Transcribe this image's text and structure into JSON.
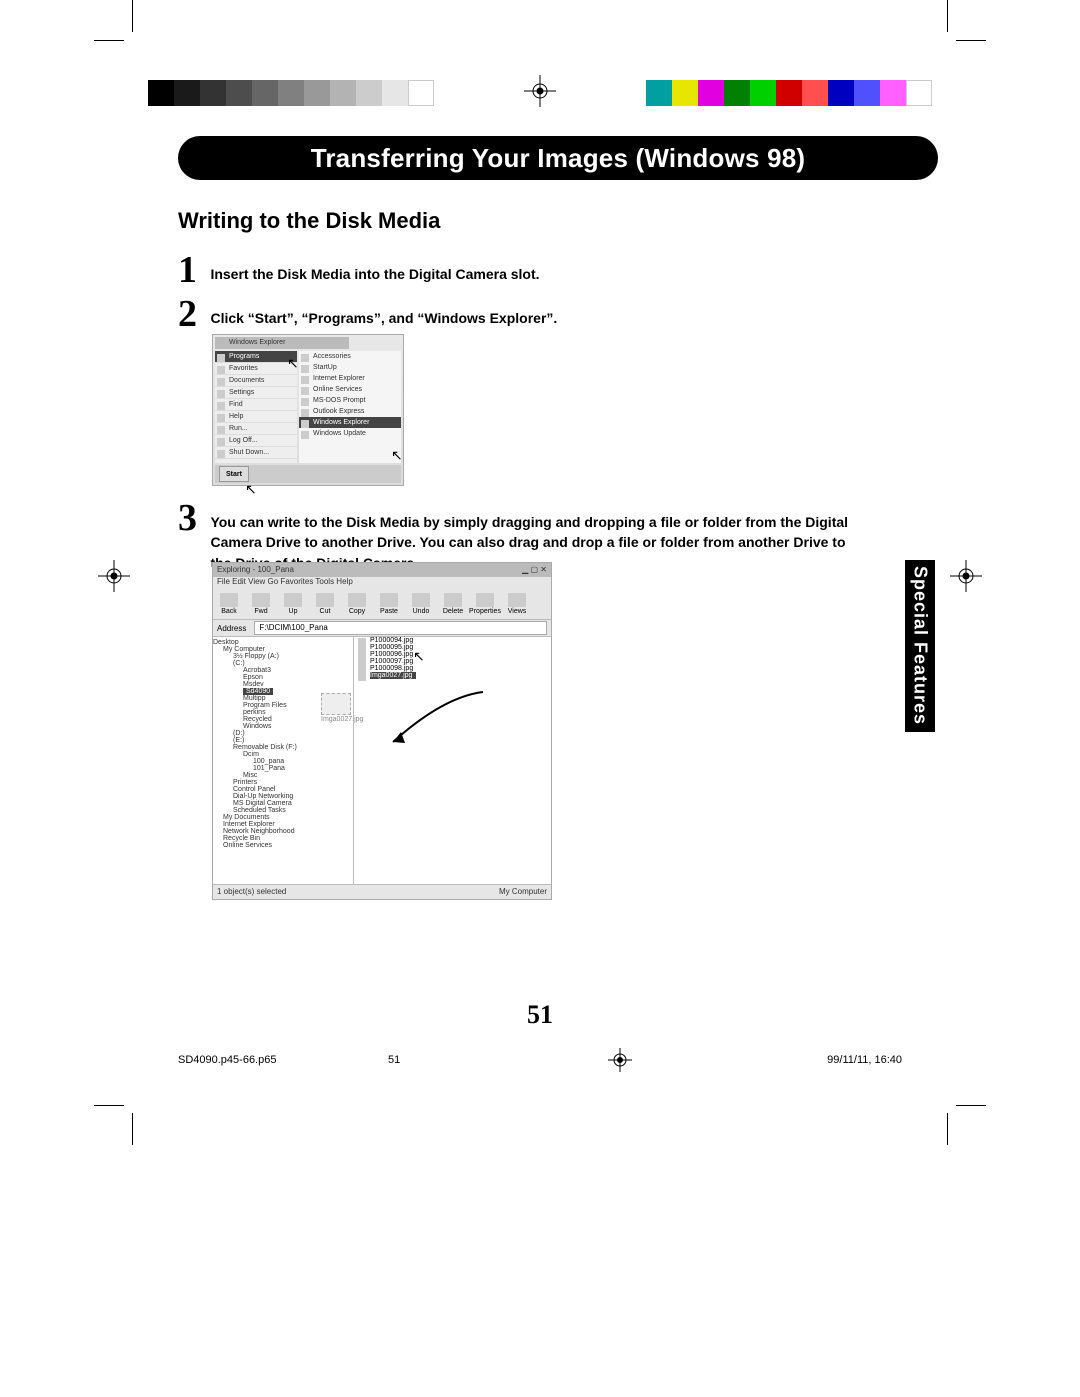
{
  "banner_title": "Transferring Your Images (Windows 98)",
  "subtitle": "Writing to the Disk Media",
  "steps": {
    "s1_num": "1",
    "s1_text": "Insert the Disk Media into the Digital Camera slot.",
    "s2_num": "2",
    "s2_text": "Click “Start”, “Programs”, and “Windows Explorer”.",
    "s3_num": "3",
    "s3_text": "You can write to the Disk Media by simply dragging and dropping a file or folder from the Digital Camera Drive to another Drive. You can also drag and drop a file or folder from another Drive to the Drive of the Digital Camera."
  },
  "fig1": {
    "window_title": "Windows Explorer",
    "left_items": [
      "Programs",
      "Favorites",
      "Documents",
      "Settings",
      "Find",
      "Help",
      "Run...",
      "Log Off...",
      "Shut Down..."
    ],
    "left_selected": "Programs",
    "right_items": [
      "Accessories",
      "StartUp",
      "Internet Explorer",
      "Online Services",
      "MS-DOS Prompt",
      "Outlook Express",
      "Windows Explorer",
      "Windows Update"
    ],
    "right_selected": "Windows Explorer",
    "start_label": "Start"
  },
  "fig2": {
    "titlebar": "Exploring - 100_Pana",
    "menubar": "File  Edit  View  Go  Favorites  Tools  Help",
    "toolbar_items": [
      "Back",
      "Fwd",
      "Up",
      "Cut",
      "Copy",
      "Paste",
      "Undo",
      "Delete",
      "Properties",
      "Views"
    ],
    "address_label": "Address",
    "address_value": "F:\\DCIM\\100_Pana",
    "tree": [
      {
        "t": "Desktop",
        "lvl": 0
      },
      {
        "t": "My Computer",
        "lvl": 1
      },
      {
        "t": "3½ Floppy (A:)",
        "lvl": 2
      },
      {
        "t": "(C:)",
        "lvl": 2
      },
      {
        "t": "Acrobat3",
        "lvl": 3
      },
      {
        "t": "Epson",
        "lvl": 3
      },
      {
        "t": "Msdev",
        "lvl": 3
      },
      {
        "t": "My Documents",
        "lvl": 3,
        "sel": true,
        "selLabel": "Sd4090"
      },
      {
        "t": "Multipp",
        "lvl": 3
      },
      {
        "t": "Program Files",
        "lvl": 3
      },
      {
        "t": "perkins",
        "lvl": 3
      },
      {
        "t": "Recycled",
        "lvl": 3
      },
      {
        "t": "Windows",
        "lvl": 3
      },
      {
        "t": "(D:)",
        "lvl": 2
      },
      {
        "t": "(E:)",
        "lvl": 2
      },
      {
        "t": "Removable Disk (F:)",
        "lvl": 2
      },
      {
        "t": "Dcim",
        "lvl": 3
      },
      {
        "t": "100_pana",
        "lvl": 4
      },
      {
        "t": "101_Pana",
        "lvl": 4
      },
      {
        "t": "Misc",
        "lvl": 3
      },
      {
        "t": "Printers",
        "lvl": 2
      },
      {
        "t": "Control Panel",
        "lvl": 2
      },
      {
        "t": "Dial-Up Networking",
        "lvl": 2
      },
      {
        "t": "MS Digital Camera",
        "lvl": 2
      },
      {
        "t": "Scheduled Tasks",
        "lvl": 2
      },
      {
        "t": "My Documents",
        "lvl": 1
      },
      {
        "t": "Internet Explorer",
        "lvl": 1
      },
      {
        "t": "Network Neighborhood",
        "lvl": 1
      },
      {
        "t": "Recycle Bin",
        "lvl": 1
      },
      {
        "t": "Online Services",
        "lvl": 1
      }
    ],
    "list_items": [
      "P1000094.jpg",
      "P1000095.jpg",
      "P1000096.jpg",
      "P1000097.jpg",
      "P1000098.jpg"
    ],
    "list_selected_extra": "Imga0027.jpg",
    "drag_ghost_label": "Imga0027.jpg",
    "status_left": "1 object(s) selected",
    "status_right": "My Computer"
  },
  "side_tab": "Special Features",
  "page_number": "51",
  "footer": {
    "file": "SD4090.p45-66.p65",
    "page": "51",
    "date": "99/11/11, 16:40"
  }
}
